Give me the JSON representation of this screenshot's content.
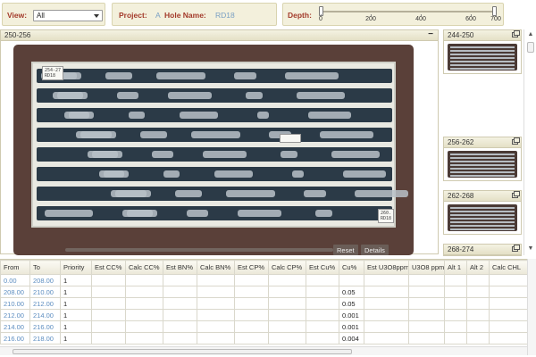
{
  "toolbar": {
    "view_label": "View:",
    "view_value": "All",
    "project_label": "Project:",
    "project_value": "A",
    "hole_label": "Hole Name:",
    "hole_value": "RD18",
    "depth_label": "Depth:",
    "depth_ticks": [
      "0",
      "200",
      "400",
      "600",
      "700"
    ],
    "depth_range": [
      0,
      700
    ]
  },
  "viewer": {
    "title": "250-256",
    "minimize_label": "−",
    "reset_label": "Reset",
    "details_label": "Details"
  },
  "thumbnails": [
    {
      "title": "244-250"
    },
    {
      "title": "256-262"
    },
    {
      "title": "262-268"
    },
    {
      "title": "268-274"
    }
  ],
  "table": {
    "columns": [
      "From",
      "To",
      "Priority",
      "Est CC%",
      "Calc CC%",
      "Est BN%",
      "Calc BN%",
      "Est CP%",
      "Calc CP%",
      "Est Cu%",
      "Cu%",
      "Est U3O8ppm",
      "U3O8 ppm",
      "Alt 1",
      "Alt 2",
      "Calc CHL"
    ],
    "rows": [
      [
        "0.00",
        "208.00",
        "1",
        "",
        "",
        "",
        "",
        "",
        "",
        "",
        "",
        "",
        "",
        "",
        "",
        ""
      ],
      [
        "208.00",
        "210.00",
        "1",
        "",
        "",
        "",
        "",
        "",
        "",
        "",
        "0.05",
        "",
        "",
        "",
        "",
        ""
      ],
      [
        "210.00",
        "212.00",
        "1",
        "",
        "",
        "",
        "",
        "",
        "",
        "",
        "0.05",
        "",
        "",
        "",
        "",
        ""
      ],
      [
        "212.00",
        "214.00",
        "1",
        "",
        "",
        "",
        "",
        "",
        "",
        "",
        "0.001",
        "",
        "",
        "",
        "",
        ""
      ],
      [
        "214.00",
        "216.00",
        "1",
        "",
        "",
        "",
        "",
        "",
        "",
        "",
        "0.001",
        "",
        "",
        "",
        "",
        ""
      ],
      [
        "216.00",
        "218.00",
        "1",
        "",
        "",
        "",
        "",
        "",
        "",
        "",
        "0.004",
        "",
        "",
        "",
        "",
        ""
      ]
    ]
  },
  "colors": {
    "label_red": "#a33a2a",
    "value_blue": "#7aa0c4",
    "panel_bg": "#f3f0dc"
  }
}
